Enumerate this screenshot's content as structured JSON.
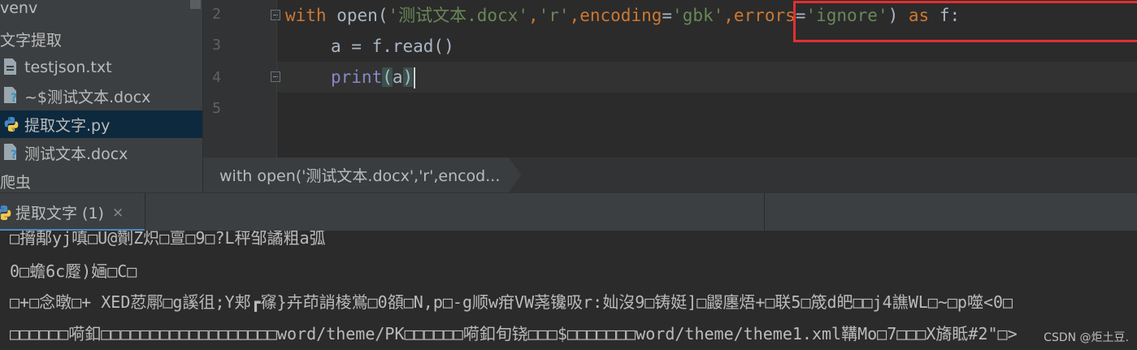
{
  "project_tree": {
    "items": [
      {
        "label": "venv",
        "icon": "folder-icon"
      },
      {
        "label": "文字提取",
        "icon": "folder-icon"
      },
      {
        "label": "testjson.txt",
        "icon": "text-file-icon"
      },
      {
        "label": "~$测试文本.docx",
        "icon": "unknown-file-icon"
      },
      {
        "label": "提取文字.py",
        "icon": "python-file-icon",
        "selected": true
      },
      {
        "label": "测试文本.docx",
        "icon": "unknown-file-icon"
      },
      {
        "label": "爬虫",
        "icon": "folder-icon"
      }
    ]
  },
  "editor": {
    "line_numbers": [
      "2",
      "3",
      "4",
      "5"
    ],
    "line2": {
      "kw_with": "with",
      "fn_open": "open",
      "p1": "(",
      "arg_file": "'测试文本.docx'",
      "c1": ",",
      "arg_mode": "'r'",
      "c2": ",",
      "kw_encoding": "encoding",
      "eq1": "=",
      "arg_gbk": "'gbk'",
      "c3": ",",
      "kw_errors": "errors",
      "eq2": "=",
      "arg_ignore": "'ignore'",
      "p2": ")",
      "kw_as": "as",
      "var_f": "f:"
    },
    "line3": "a = f.read()",
    "line4": {
      "fn_print": "print",
      "p1": "(",
      "arg": "a",
      "p2": ")"
    },
    "breadcrumb": "with open('测试文本.docx','r',encod..."
  },
  "run_panel": {
    "tab_label": "提取文字 (1)",
    "close_glyph": "×",
    "output_lines": [
      "□搚鄅yj嗔□U@劗Z炽□亶□9□?L秤邹譎粗a弧",
      "0□蟾6c蹷)婳□C□",
      "□+□念暾□+ XED荵鄏□g謑徂;Y郏┏窱}卉茚誚棱鴬□0頟□N,p□-g顺w疳VW荛镵吸r:奾沒9□铸娗]□鼹廛焐+□联5□筬d皅□□j4譙WL□~□p噬<0□",
      "□□□□□□嗬釦□□□□□□□□□□□□□□□□□□word/theme/PK□□□□□□嗬釦旬铙□□□$□□□□□□□word/theme/theme1.xml鞲Mo□7□□□X旖眡#2\"□>"
    ],
    "watermark": "CSDN @炬土豆."
  },
  "colors": {
    "keyword": "#cc7832",
    "string": "#6a8759",
    "builtin": "#8888c6",
    "highlight_box": "#e03030",
    "selection": "#0d293e"
  }
}
